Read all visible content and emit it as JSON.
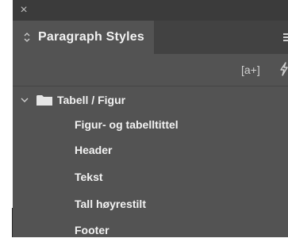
{
  "panel": {
    "close_symbol": "×",
    "tab_label": "Paragraph Styles",
    "toolbar": {
      "new_group_label": "[a+]"
    },
    "group": {
      "label": "Tabell / Figur"
    },
    "styles": [
      {
        "label": "Figur- og tabelltittel"
      },
      {
        "label": "Header"
      },
      {
        "label": "Tekst"
      },
      {
        "label": "Tall høyrestilt"
      },
      {
        "label": "Footer"
      }
    ]
  },
  "icons": [
    "close-icon",
    "tab-toggle-icon",
    "panel-menu-icon",
    "lightning-icon",
    "chevron-down-icon",
    "folder-icon"
  ],
  "colors": {
    "panel_bg": "#535353",
    "titlebar_bg": "#3b3b3b",
    "tabbar_bg": "#424242",
    "text": "#f2f2f2",
    "icon": "#cfcfcf"
  }
}
